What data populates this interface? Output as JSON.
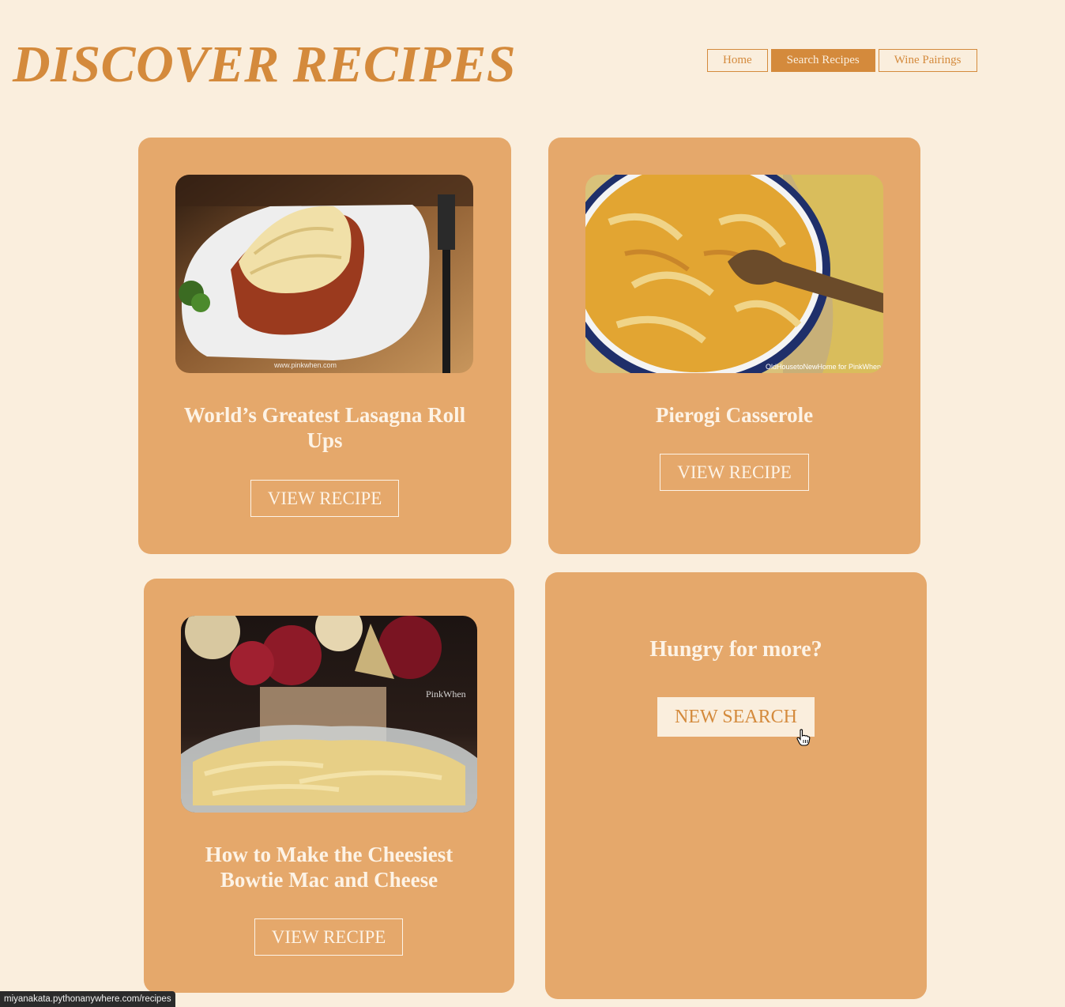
{
  "header": {
    "title": "DISCOVER RECIPES"
  },
  "nav": {
    "items": [
      {
        "label": "Home",
        "active": false
      },
      {
        "label": "Search Recipes",
        "active": true
      },
      {
        "label": "Wine Pairings",
        "active": false
      }
    ]
  },
  "recipes": [
    {
      "title": "World’s Greatest Lasagna Roll Ups",
      "button": "VIEW RECIPE",
      "watermark": "www.pinkwhen.com"
    },
    {
      "title": "Pierogi Casserole",
      "button": "VIEW RECIPE",
      "watermark": "OldHousetoNewHome for PinkWhen"
    },
    {
      "title": "How to Make the Cheesiest Bowtie Mac and Cheese",
      "button": "VIEW RECIPE",
      "watermark": "PinkWhen"
    }
  ],
  "more": {
    "title": "Hungry for more?",
    "button": "NEW SEARCH"
  },
  "status_bar": {
    "url": "miyanakata.pythonanywhere.com/recipes"
  },
  "colors": {
    "background": "#faeedd",
    "accent": "#d48a3c",
    "card": "#e5a86b",
    "card_text": "#fdf3e6"
  }
}
